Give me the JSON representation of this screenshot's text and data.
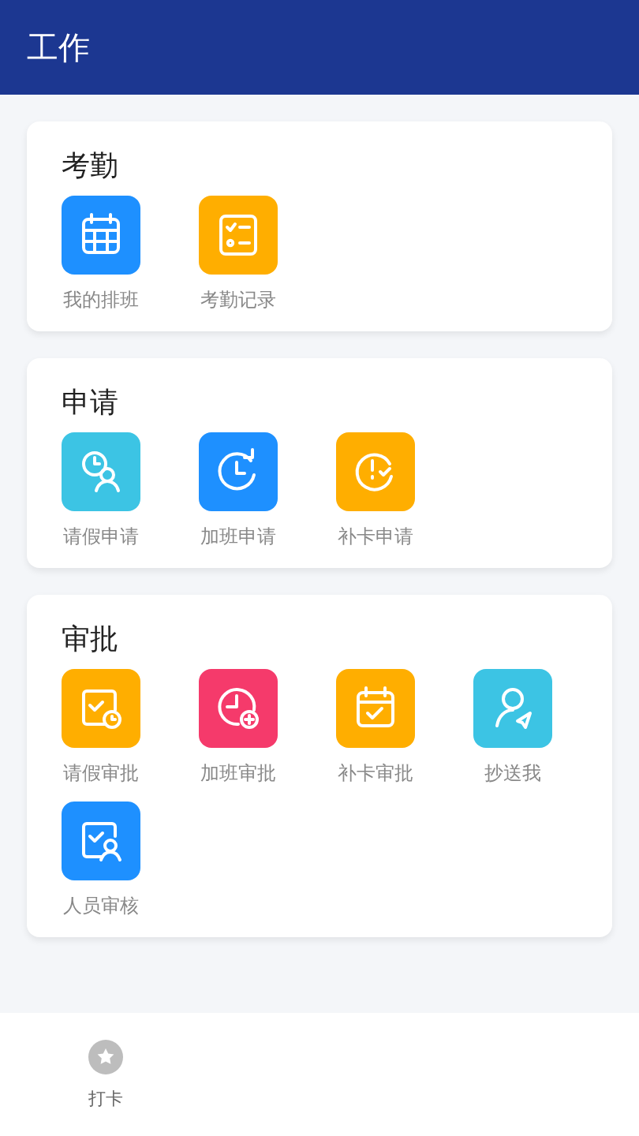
{
  "header": {
    "title": "工作"
  },
  "sections": [
    {
      "title": "考勤",
      "items": [
        {
          "label": "我的排班",
          "kind": "calendar-grid",
          "color": "#1e90ff"
        },
        {
          "label": "考勤记录",
          "kind": "checklist",
          "color": "#ffae00"
        }
      ]
    },
    {
      "title": "申请",
      "items": [
        {
          "label": "请假申请",
          "kind": "clock-person",
          "color": "#3cc4e4"
        },
        {
          "label": "加班申请",
          "kind": "clock-arrow",
          "color": "#1e90ff"
        },
        {
          "label": "补卡申请",
          "kind": "clock-alert",
          "color": "#ffae00"
        }
      ]
    },
    {
      "title": "审批",
      "items": [
        {
          "label": "请假审批",
          "kind": "doc-clock",
          "color": "#ffae00"
        },
        {
          "label": "加班审批",
          "kind": "clock-plus",
          "color": "#f53a6b"
        },
        {
          "label": "补卡审批",
          "kind": "calendar-check",
          "color": "#ffae00"
        },
        {
          "label": "抄送我",
          "kind": "person-send",
          "color": "#3cc4e4"
        },
        {
          "label": "人员审核",
          "kind": "doc-person",
          "color": "#1e90ff"
        }
      ]
    }
  ],
  "tabbar": [
    {
      "label": "打卡",
      "selected": false
    }
  ]
}
